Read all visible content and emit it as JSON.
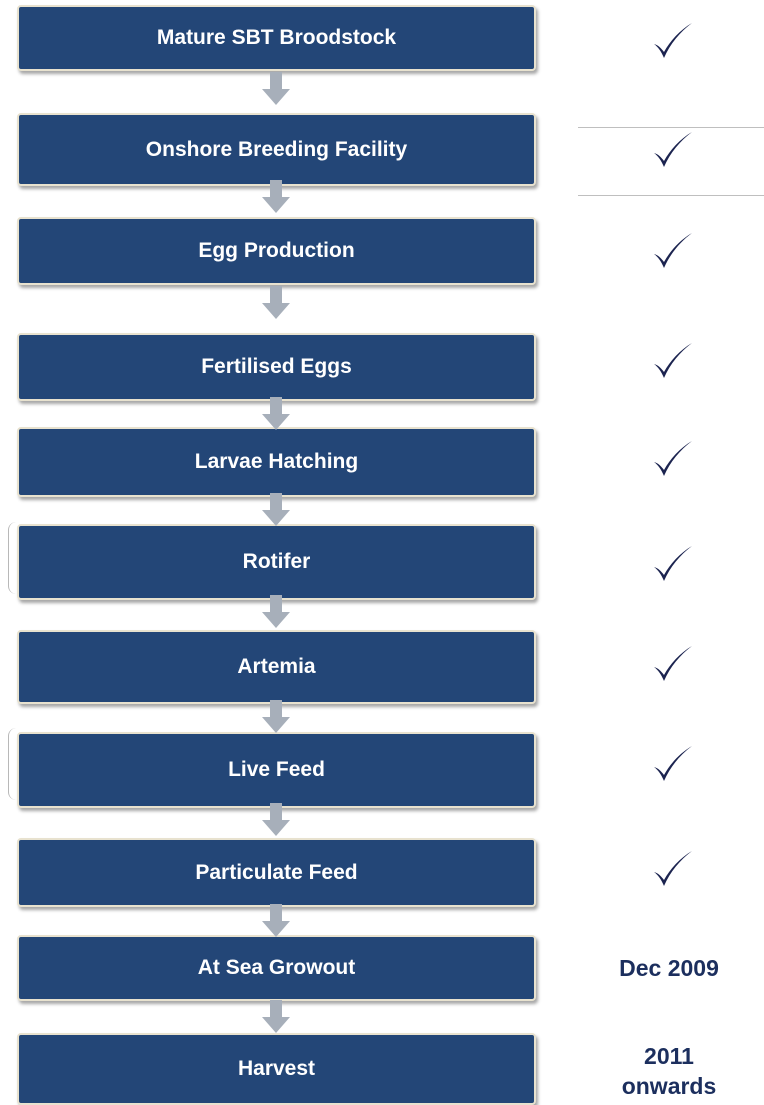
{
  "steps": [
    {
      "label": "Mature SBT Broodstock",
      "status": "check-icon"
    },
    {
      "label": "Onshore Breeding Facility",
      "status": "check-icon"
    },
    {
      "label": "Egg Production",
      "status": "check-icon"
    },
    {
      "label": "Fertilised Eggs",
      "status": "check-icon"
    },
    {
      "label": "Larvae Hatching",
      "status": "check-icon"
    },
    {
      "label": "Rotifer",
      "status": "check-icon"
    },
    {
      "label": "Artemia",
      "status": "check-icon"
    },
    {
      "label": "Live Feed",
      "status": "check-icon"
    },
    {
      "label": "Particulate Feed",
      "status": "check-icon"
    },
    {
      "label": "At Sea Growout",
      "status_text": "Dec 2009"
    },
    {
      "label": "Harvest",
      "status_text": [
        "2011",
        "onwards"
      ]
    }
  ],
  "colors": {
    "box": "#234677",
    "box_border": "#e8e2cf",
    "arrow": "#a7afba",
    "check": "#1c2450",
    "status_text": "#1c2f5e"
  }
}
